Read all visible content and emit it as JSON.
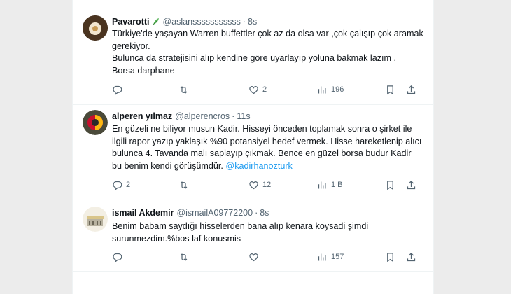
{
  "tweets": [
    {
      "name": "Pavarotti",
      "handle": "@aslansssssssssss",
      "dot": "·",
      "time": "8s",
      "lines": [
        "Türkiye'de yaşayan Warren buffettler çok az da olsa var ,çok çalışıp çok aramak gerekiyor.",
        "Bulunca da stratejisini alıp kendine göre uyarlayıp yoluna bakmak lazım .",
        "Borsa darphane"
      ],
      "mention": "",
      "replies": "",
      "retweets": "",
      "likes": "2",
      "views": "196"
    },
    {
      "name": "alperen yılmaz",
      "handle": "@alperencros",
      "dot": "·",
      "time": "11s",
      "lines": [
        "En güzeli ne biliyor musun Kadir. Hisseyi önceden  toplamak sonra o şirket ile ilgili rapor yazıp yaklaşık %90 potansiyel hedef vermek. Hisse hareketlenip alıcı bulunca 4. Tavanda malı saplayıp çıkmak. Bence en güzel borsa budur Kadir bu benim kendi görüşümdür."
      ],
      "mention": "@kadirhanozturk",
      "replies": "2",
      "retweets": "",
      "likes": "12",
      "views": "1 B"
    },
    {
      "name": "ismail Akdemir",
      "handle": "@ismailA09772200",
      "dot": "·",
      "time": "8s",
      "lines": [
        "Benim babam saydığı hisselerden bana alıp kenara koysadi şimdi surunmezdim.%bos laf konusmis"
      ],
      "mention": "",
      "replies": "",
      "retweets": "",
      "likes": "",
      "views": "157"
    }
  ],
  "icons": [
    "reply-icon",
    "retweet-icon",
    "like-icon",
    "views-icon",
    "bookmark-icon",
    "share-icon",
    "verified-leaf-icon"
  ],
  "colors": {
    "text": "#0f1419",
    "muted": "#536471",
    "link": "#1d9bf0",
    "border": "#eff3f4",
    "background": "#ececec"
  }
}
